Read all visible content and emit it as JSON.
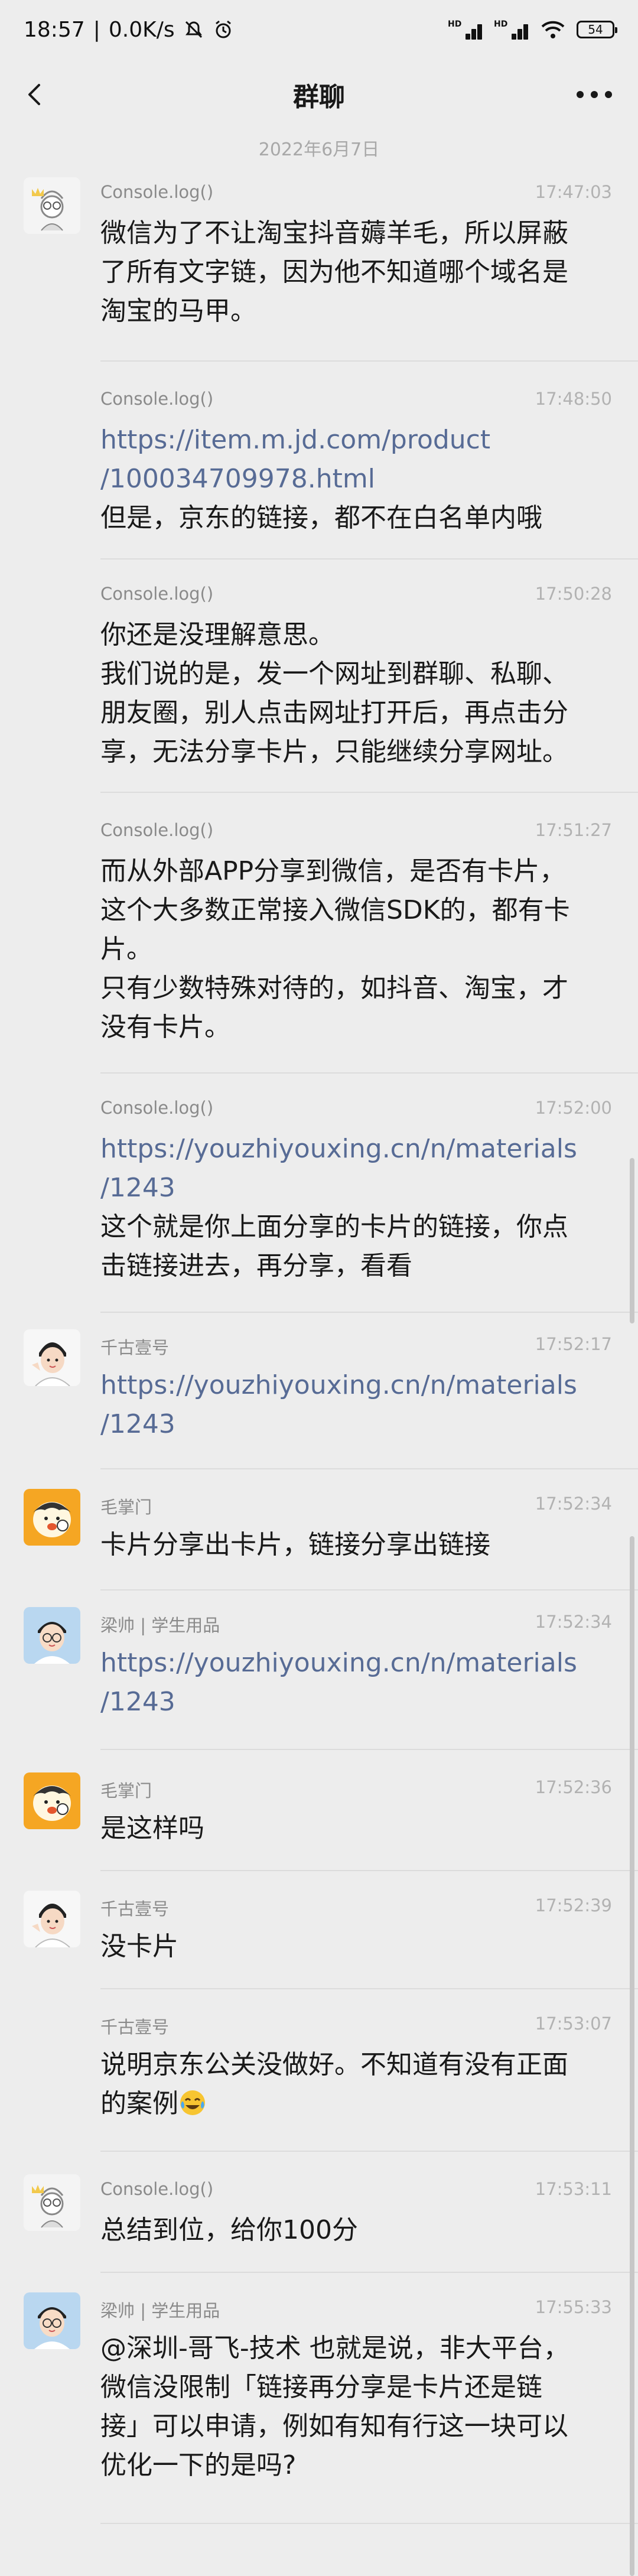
{
  "status": {
    "time": "18:57",
    "speed": "0.0K/s",
    "battery": "54"
  },
  "nav": {
    "title": "群聊"
  },
  "date": "2022年6月7日",
  "messages": [
    {
      "sender": "Console.log()",
      "time": "17:47:03",
      "lines": [
        "微信为了不让淘宝抖音薅羊毛，所以屏蔽",
        "了所有文字链，因为他不知道哪个域名是",
        "淘宝的马甲。"
      ]
    },
    {
      "sender": "Console.log()",
      "time": "17:48:50",
      "link": [
        "https://item.m.jd.com/product",
        "/100034709978.html"
      ],
      "lines": [
        "但是，京东的链接，都不在白名单内哦"
      ]
    },
    {
      "sender": "Console.log()",
      "time": "17:50:28",
      "lines": [
        "你还是没理解意思。",
        "我们说的是，发一个网址到群聊、私聊、",
        "朋友圈，别人点击网址打开后，再点击分",
        "享，无法分享卡片，只能继续分享网址。"
      ]
    },
    {
      "sender": "Console.log()",
      "time": "17:51:27",
      "lines": [
        "而从外部APP分享到微信，是否有卡片，",
        "这个大多数正常接入微信SDK的，都有卡",
        "片。",
        "只有少数特殊对待的，如抖音、淘宝，才",
        "没有卡片。"
      ]
    },
    {
      "sender": "Console.log()",
      "time": "17:52:00",
      "link": [
        "https://youzhiyouxing.cn/n/materials",
        "/1243"
      ],
      "lines": [
        "这个就是你上面分享的卡片的链接，你点",
        "击链接进去，再分享，看看"
      ]
    },
    {
      "sender": "千古壹号",
      "time": "17:52:17",
      "link": [
        "https://youzhiyouxing.cn/n/materials",
        "/1243"
      ],
      "lines": []
    },
    {
      "sender": "毛掌门",
      "time": "17:52:34",
      "lines": [
        "卡片分享出卡片，链接分享出链接"
      ]
    },
    {
      "sender": "梁帅 | 学生用品",
      "time": "17:52:34",
      "link": [
        "https://youzhiyouxing.cn/n/materials",
        "/1243"
      ],
      "lines": []
    },
    {
      "sender": "毛掌门",
      "time": "17:52:36",
      "lines": [
        "是这样吗"
      ]
    },
    {
      "sender": "千古壹号",
      "time": "17:52:39",
      "lines": [
        "没卡片"
      ]
    },
    {
      "sender": "千古壹号",
      "time": "17:53:07",
      "lines": [
        "说明京东公关没做好。不知道有没有正面",
        "的案例"
      ]
    },
    {
      "sender": "Console.log()",
      "time": "17:53:11",
      "lines": [
        "总结到位，给你100分"
      ]
    },
    {
      "sender": "梁帅 | 学生用品",
      "time": "17:55:33",
      "lines": [
        "@深圳-哥飞-技术 也就是说，非大平台，",
        "微信没限制「链接再分享是卡片还是链",
        "接」可以申请，例如有知有行这一块可以",
        "优化一下的是吗?"
      ]
    }
  ]
}
